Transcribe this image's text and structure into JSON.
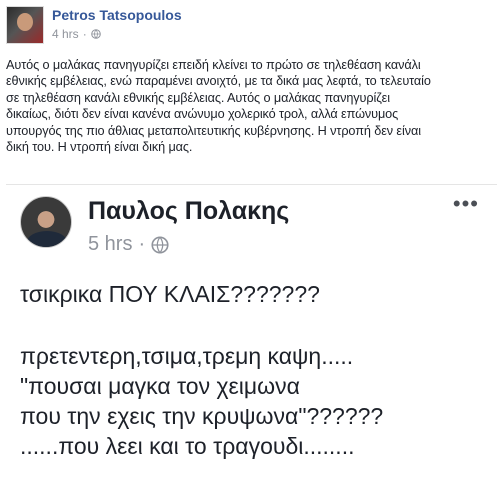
{
  "post": {
    "author": "Petros Tatsopoulos",
    "time": "4 hrs",
    "body_lines": [
      "Αυτός ο μαλάκας πανηγυρίζει επειδή κλείνει το πρώτο σε τηλεθέαση κανάλι",
      "εθνικής εμβέλειας, ενώ παραμένει ανοιχτό, με τα δικά μας λεφτά, το τελευταίο",
      "σε τηλεθέαση κανάλι εθνικής εμβέλειας. Αυτός ο μαλάκας πανηγυρίζει",
      "δικαίως, διότι δεν είναι κανένα ανώνυμο χολερικό τρολ, αλλά επώνυμος",
      "υπουργός της πιο άθλιας μεταπολιτευτικής κυβέρνησης. Η ντροπή δεν είναι",
      "δική του. Η ντροπή είναι δική μας."
    ]
  },
  "shared": {
    "author": "Παυλος Πολακης",
    "time": "5 hrs",
    "text_lines": [
      "τσικρικα ΠΟΥ ΚΛΑΙΣ???????",
      "",
      "πρετεντερη,τσιμα,τρεμη καψη.....",
      "\"πουσαι μαγκα τον χειμωνα",
      "που την εχεις την κρυψωνα\"??????",
      "......που λεει και το τραγουδι........"
    ]
  },
  "icons": {
    "menu": "more-options-icon",
    "audience": "globe-icon"
  }
}
